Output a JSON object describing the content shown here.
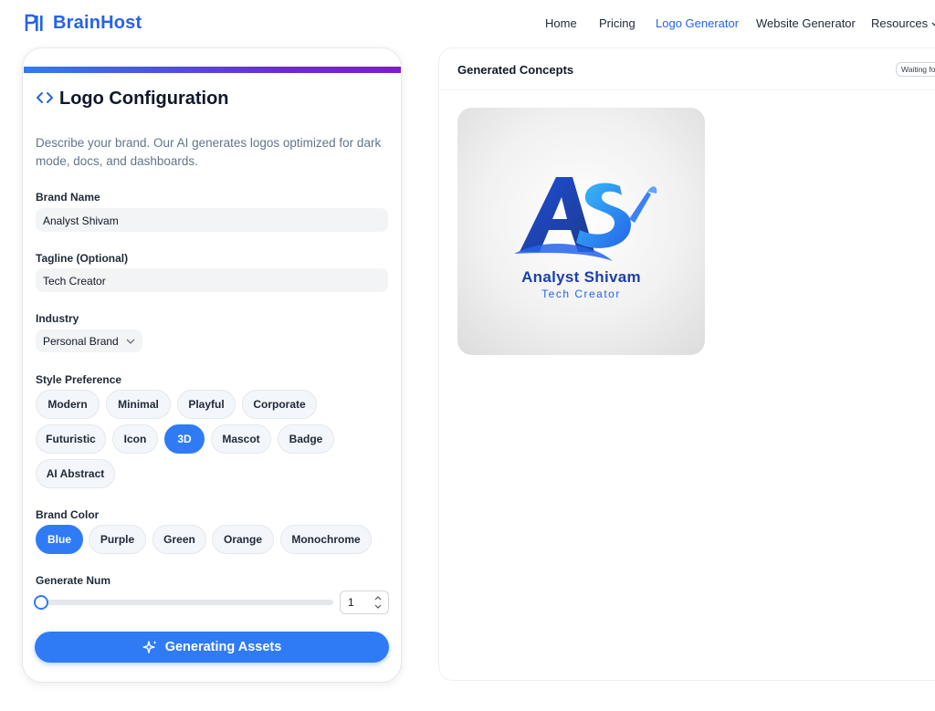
{
  "header": {
    "brand": "BrainHost",
    "nav": [
      "Home",
      "Pricing",
      "Logo Generator",
      "Website Generator",
      "Resources"
    ],
    "active_nav": "Logo Generator"
  },
  "config": {
    "title": "Logo Configuration",
    "description": "Describe your brand. Our AI generates logos optimized for dark mode, docs, and dashboards.",
    "brand_name_label": "Brand Name",
    "brand_name_value": "Analyst Shivam",
    "tagline_label": "Tagline (Optional)",
    "tagline_value": "Tech Creator",
    "industry_label": "Industry",
    "industry_value": "Personal Brand",
    "style_label": "Style Preference",
    "styles": [
      "Modern",
      "Minimal",
      "Playful",
      "Corporate",
      "Futuristic",
      "Icon",
      "3D",
      "Mascot",
      "Badge",
      "AI Abstract"
    ],
    "selected_style": "3D",
    "color_label": "Brand Color",
    "colors": [
      "Blue",
      "Purple",
      "Green",
      "Orange",
      "Monochrome"
    ],
    "selected_color": "Blue",
    "generate_num_label": "Generate Num",
    "generate_num_value": "1",
    "generate_button": "Generating Assets"
  },
  "concepts": {
    "title": "Generated Concepts",
    "status": "Waiting fo",
    "logo_name": "Analyst Shivam",
    "logo_tagline": "Tech Creator"
  },
  "colors": {
    "accent": "#2f7bf5",
    "brand": "#2563eb",
    "gradient_end": "#7c1dd4"
  }
}
